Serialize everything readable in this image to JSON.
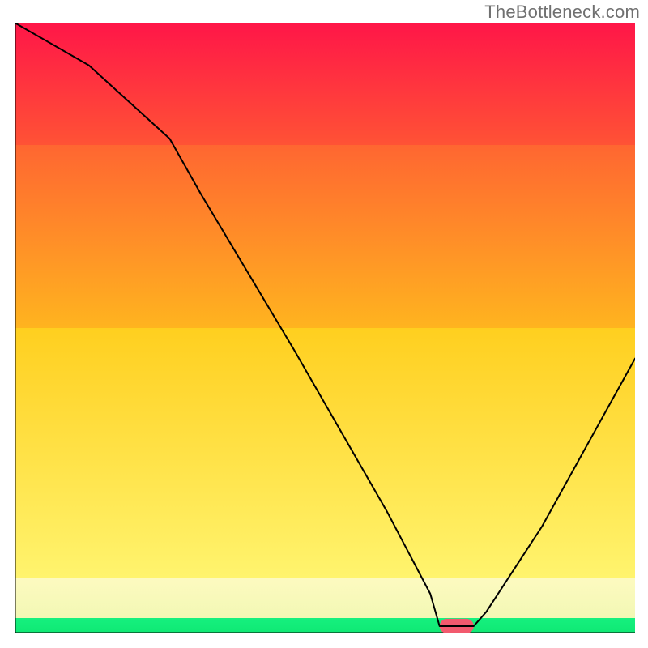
{
  "watermark": "TheBottleneck.com",
  "chart_data": {
    "type": "line",
    "title": "",
    "xlabel": "",
    "ylabel": "",
    "xlim": [
      0,
      100
    ],
    "ylim": [
      0,
      100
    ],
    "gradient_bands": [
      {
        "name": "green",
        "y0": 0.0,
        "y1": 2.5,
        "color_top": "#16f07e",
        "color_bot": "#0fe874"
      },
      {
        "name": "cream",
        "y0": 2.5,
        "y1": 9.0,
        "color_top": "#fdfac0",
        "color_bot": "#f2f8b4"
      },
      {
        "name": "yellow",
        "y0": 9.0,
        "y1": 50.0,
        "color_top": "#ffcf1f",
        "color_bot": "#fff46e"
      },
      {
        "name": "orange",
        "y0": 50.0,
        "y1": 80.0,
        "color_top": "#ff6631",
        "color_bot": "#ffb41f"
      },
      {
        "name": "red",
        "y0": 80.0,
        "y1": 100.0,
        "color_top": "#ff1648",
        "color_bot": "#ff5235"
      }
    ],
    "plateau_marker": {
      "x0": 68.5,
      "x1": 74.0,
      "y": 1.2,
      "color": "#f25a6e",
      "thickness": 2.4
    },
    "series": [
      {
        "name": "bottleneck-curve",
        "color": "#000000",
        "stroke_width": 2,
        "x": [
          0,
          12,
          25,
          30,
          45,
          60,
          67,
          68.5,
          74,
          76,
          85,
          100
        ],
        "values": [
          104,
          93,
          81,
          72,
          46.5,
          20,
          6.5,
          1.2,
          1.2,
          3.5,
          17.5,
          45
        ]
      }
    ]
  }
}
